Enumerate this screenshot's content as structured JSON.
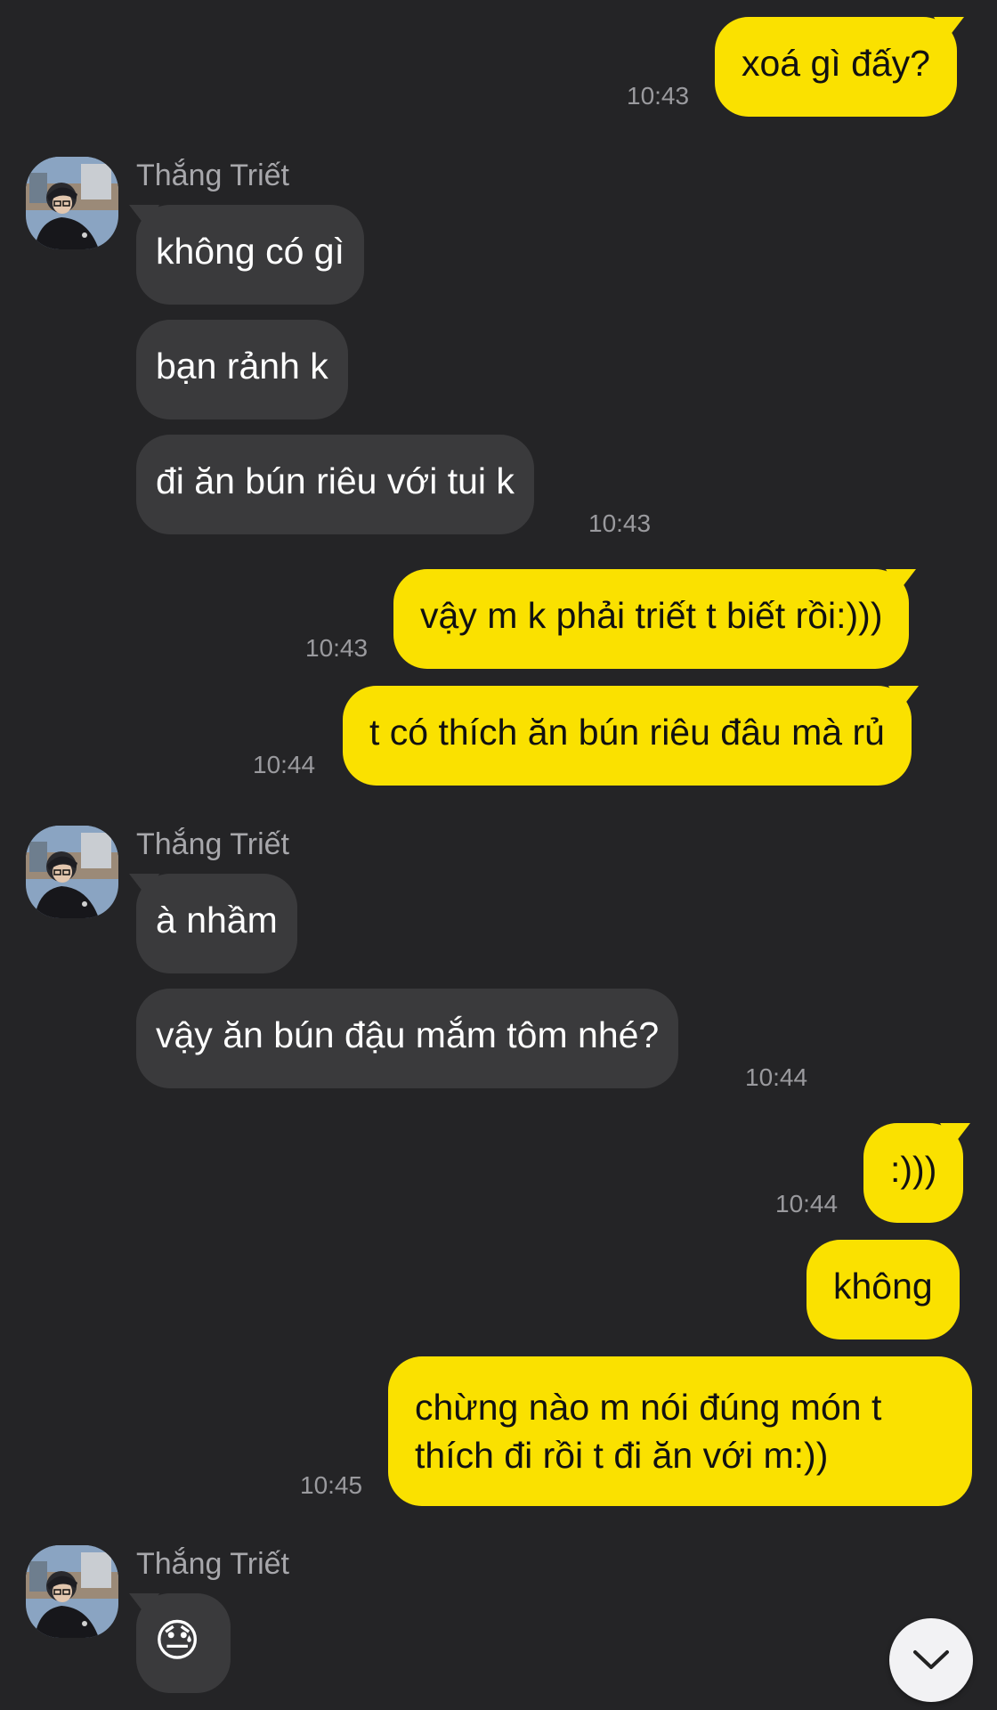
{
  "messages": [
    {
      "dir": "out",
      "text": "xoá gì đấy?",
      "time": "10:43"
    },
    {
      "dir": "in",
      "sender": "Thắng Triết",
      "text": "không có gì"
    },
    {
      "dir": "in",
      "text": "bạn rảnh k"
    },
    {
      "dir": "in",
      "text": "đi ăn bún riêu với tui k",
      "time": "10:43"
    },
    {
      "dir": "out",
      "text": "vậy m k phải triết t biết rồi:)))",
      "time": "10:43"
    },
    {
      "dir": "out",
      "text": "t có thích ăn bún riêu đâu mà rủ",
      "time": "10:44"
    },
    {
      "dir": "in",
      "sender": "Thắng Triết",
      "text": "à nhầm"
    },
    {
      "dir": "in",
      "text": "vậy ăn bún đậu mắm tôm nhé?",
      "time": "10:44"
    },
    {
      "dir": "out",
      "text": ":)))",
      "time": "10:44"
    },
    {
      "dir": "out",
      "text": "không"
    },
    {
      "dir": "out",
      "text": "chừng nào m nói đúng món t thích đi rồi t đi ăn với m:))",
      "time": "10:45"
    },
    {
      "dir": "in",
      "sender": "Thắng Triết",
      "text": "😓"
    }
  ],
  "colors": {
    "background": "#242426",
    "outgoing_bubble": "#fae100",
    "incoming_bubble": "#3a3a3c",
    "timestamp": "#9a9a9e",
    "sender_name": "#a7a7ab"
  },
  "icons": {
    "scroll_down": "chevron-down-icon",
    "avatar": "contact-avatar"
  }
}
